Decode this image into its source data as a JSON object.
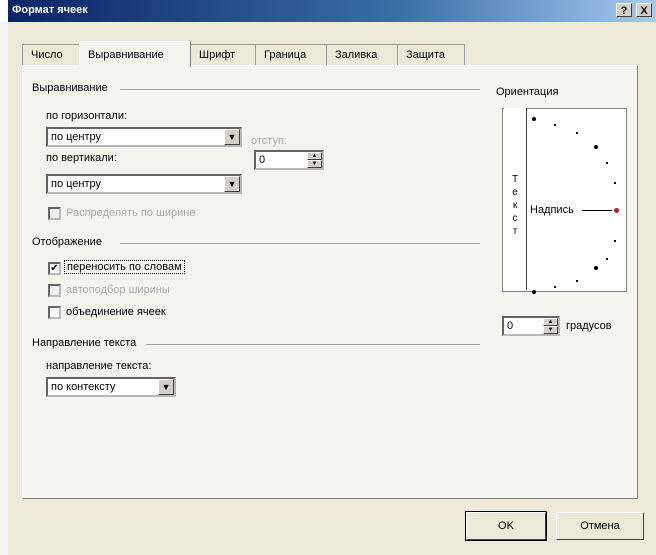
{
  "window": {
    "title": "Формат ячеек",
    "help_glyph": "?",
    "close_glyph": "X"
  },
  "tabs": [
    "Число",
    "Выравнивание",
    "Шрифт",
    "Граница",
    "Заливка",
    "Защита"
  ],
  "active_tab": "Выравнивание",
  "alignment": {
    "group_label": "Выравнивание",
    "horizontal_label": "по горизонтали:",
    "horizontal_value": "по центру",
    "indent_label": "отступ:",
    "indent_value": "0",
    "vertical_label": "по вертикали:",
    "vertical_value": "по центру",
    "distribute_label": "Распределять по ширине",
    "distribute_checked": false
  },
  "display": {
    "group_label": "Отображение",
    "wrap_label": "переносить по словам",
    "wrap_checked": true,
    "autofit_label": "автоподбор ширины",
    "autofit_checked": false,
    "merge_label": "объединение ячеек",
    "merge_checked": false
  },
  "direction": {
    "group_label": "Направление текста",
    "direction_label": "направление текста:",
    "direction_value": "по контексту"
  },
  "orientation": {
    "group_label": "Ориентация",
    "vertical_text": [
      "Т",
      "е",
      "к",
      "с",
      "т"
    ],
    "caption": "Надпись",
    "degrees_value": "0",
    "degrees_label": "градусов",
    "indicator_color": "#c0181c"
  },
  "buttons": {
    "ok": "OK",
    "cancel": "Отмена"
  },
  "colors": {
    "title_bar": "#0a246a",
    "dialog_bg": "#ece9d8"
  }
}
